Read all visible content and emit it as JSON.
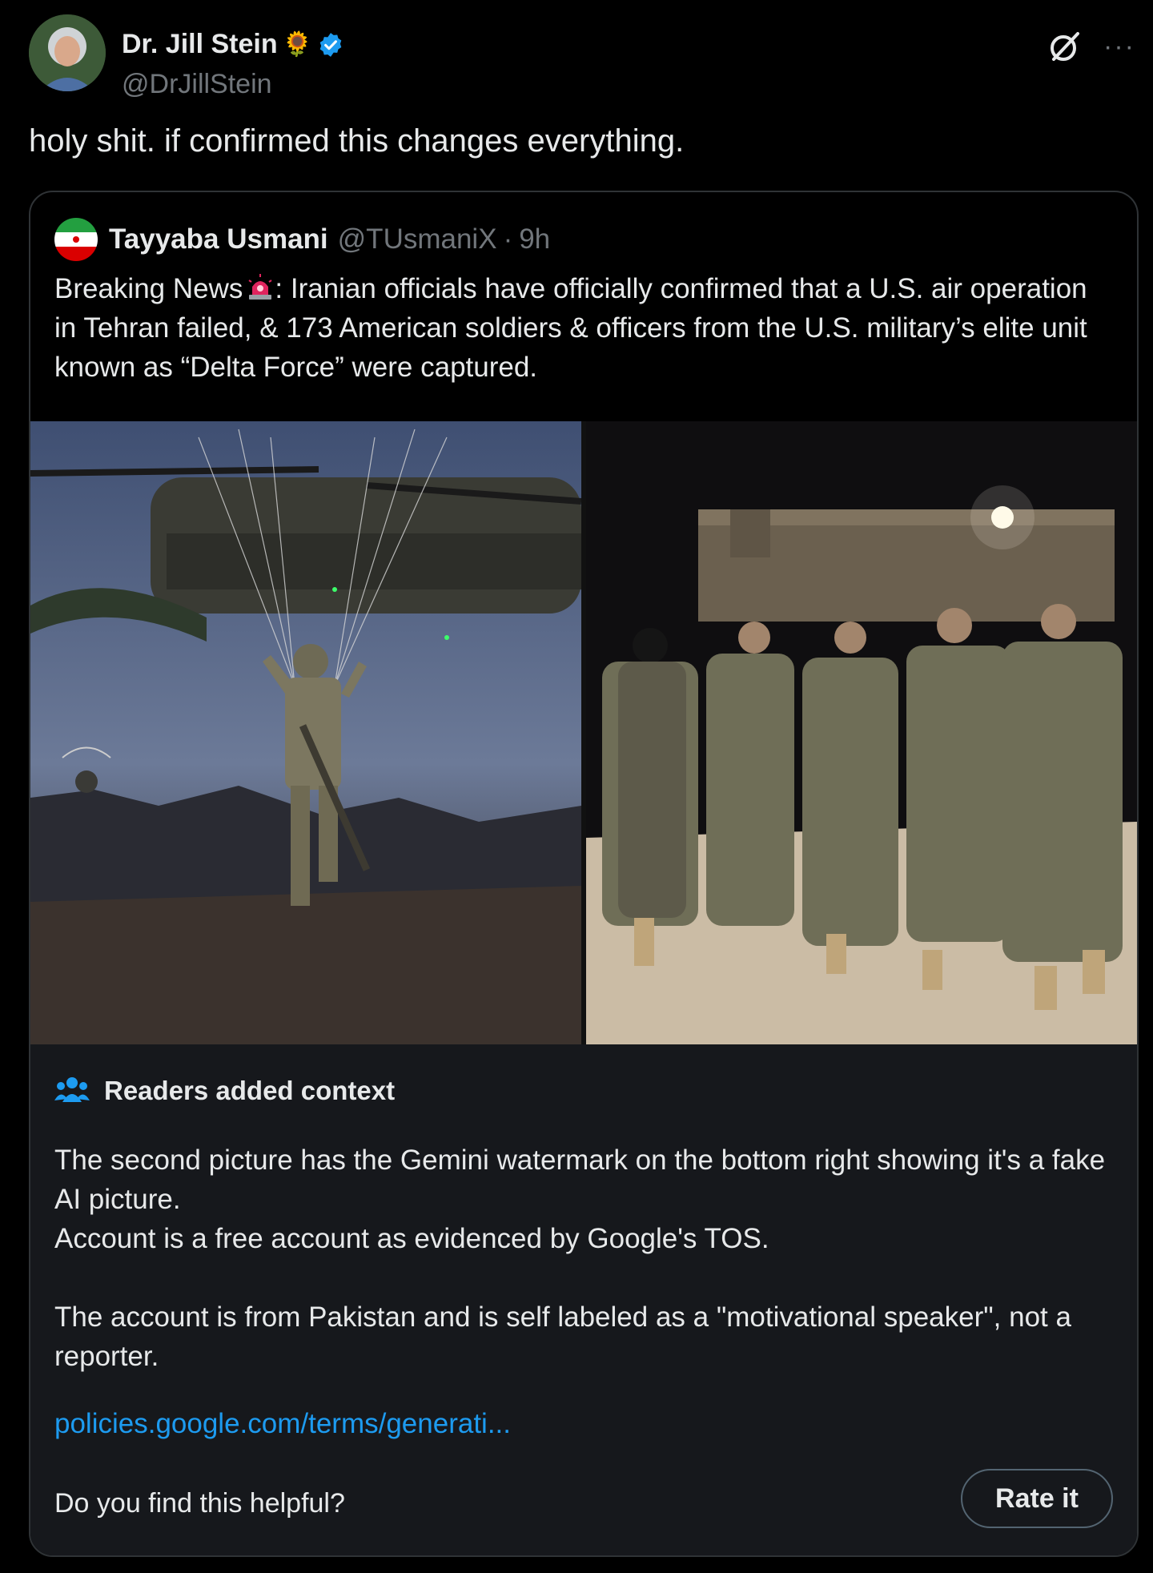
{
  "post": {
    "author_name": "Dr. Jill Stein",
    "author_emoji": "🌻",
    "author_handle": "@DrJillStein",
    "text": "holy shit. if confirmed this changes everything."
  },
  "quote": {
    "author_name": "Tayyaba Usmani",
    "author_handle": "@TUsmaniX",
    "dot": "·",
    "time": "9h",
    "text_before_emoji": "Breaking News",
    "text_after_emoji": ": Iranian officials have officially confirmed that a U.S. air operation in Tehran failed, & 173 American soldiers & officers from the U.S. military’s elite unit known as “Delta Force” were captured."
  },
  "note": {
    "title": "Readers added context",
    "line1": "The second picture has the Gemini watermark on the bottom right showing it's a fake AI picture.",
    "line2": "Account is a free account as evidenced by Google's TOS.",
    "line3": "The account is from Pakistan and is self labeled as a \"motivational speaker\", not a reporter.",
    "link": "policies.google.com/terms/generati...",
    "helpful_prompt": "Do you find this helpful?",
    "rate_button": "Rate it"
  },
  "colors": {
    "background": "#000000",
    "text_primary": "#e7e9ea",
    "text_secondary": "#71767b",
    "link": "#1d9bf0",
    "verified": "#1d9bf0",
    "note_background": "#16181c"
  },
  "icons": [
    "verified-badge-icon",
    "grok-icon",
    "more-icon",
    "iran-flag-icon",
    "siren-icon",
    "people-icon"
  ]
}
